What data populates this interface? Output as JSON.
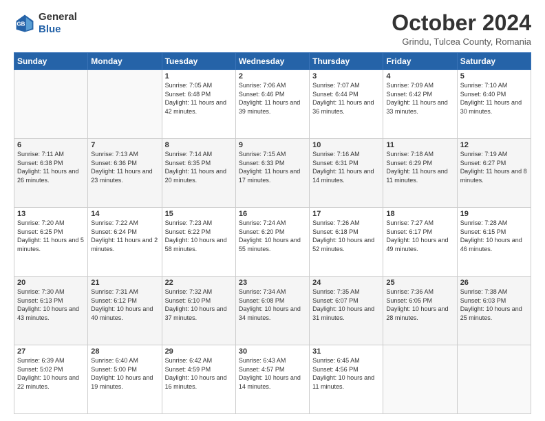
{
  "logo": {
    "line1": "General",
    "line2": "Blue"
  },
  "title": "October 2024",
  "subtitle": "Grindu, Tulcea County, Romania",
  "days_header": [
    "Sunday",
    "Monday",
    "Tuesday",
    "Wednesday",
    "Thursday",
    "Friday",
    "Saturday"
  ],
  "weeks": [
    [
      {
        "day": "",
        "info": ""
      },
      {
        "day": "",
        "info": ""
      },
      {
        "day": "1",
        "info": "Sunrise: 7:05 AM\nSunset: 6:48 PM\nDaylight: 11 hours and 42 minutes."
      },
      {
        "day": "2",
        "info": "Sunrise: 7:06 AM\nSunset: 6:46 PM\nDaylight: 11 hours and 39 minutes."
      },
      {
        "day": "3",
        "info": "Sunrise: 7:07 AM\nSunset: 6:44 PM\nDaylight: 11 hours and 36 minutes."
      },
      {
        "day": "4",
        "info": "Sunrise: 7:09 AM\nSunset: 6:42 PM\nDaylight: 11 hours and 33 minutes."
      },
      {
        "day": "5",
        "info": "Sunrise: 7:10 AM\nSunset: 6:40 PM\nDaylight: 11 hours and 30 minutes."
      }
    ],
    [
      {
        "day": "6",
        "info": "Sunrise: 7:11 AM\nSunset: 6:38 PM\nDaylight: 11 hours and 26 minutes."
      },
      {
        "day": "7",
        "info": "Sunrise: 7:13 AM\nSunset: 6:36 PM\nDaylight: 11 hours and 23 minutes."
      },
      {
        "day": "8",
        "info": "Sunrise: 7:14 AM\nSunset: 6:35 PM\nDaylight: 11 hours and 20 minutes."
      },
      {
        "day": "9",
        "info": "Sunrise: 7:15 AM\nSunset: 6:33 PM\nDaylight: 11 hours and 17 minutes."
      },
      {
        "day": "10",
        "info": "Sunrise: 7:16 AM\nSunset: 6:31 PM\nDaylight: 11 hours and 14 minutes."
      },
      {
        "day": "11",
        "info": "Sunrise: 7:18 AM\nSunset: 6:29 PM\nDaylight: 11 hours and 11 minutes."
      },
      {
        "day": "12",
        "info": "Sunrise: 7:19 AM\nSunset: 6:27 PM\nDaylight: 11 hours and 8 minutes."
      }
    ],
    [
      {
        "day": "13",
        "info": "Sunrise: 7:20 AM\nSunset: 6:25 PM\nDaylight: 11 hours and 5 minutes."
      },
      {
        "day": "14",
        "info": "Sunrise: 7:22 AM\nSunset: 6:24 PM\nDaylight: 11 hours and 2 minutes."
      },
      {
        "day": "15",
        "info": "Sunrise: 7:23 AM\nSunset: 6:22 PM\nDaylight: 10 hours and 58 minutes."
      },
      {
        "day": "16",
        "info": "Sunrise: 7:24 AM\nSunset: 6:20 PM\nDaylight: 10 hours and 55 minutes."
      },
      {
        "day": "17",
        "info": "Sunrise: 7:26 AM\nSunset: 6:18 PM\nDaylight: 10 hours and 52 minutes."
      },
      {
        "day": "18",
        "info": "Sunrise: 7:27 AM\nSunset: 6:17 PM\nDaylight: 10 hours and 49 minutes."
      },
      {
        "day": "19",
        "info": "Sunrise: 7:28 AM\nSunset: 6:15 PM\nDaylight: 10 hours and 46 minutes."
      }
    ],
    [
      {
        "day": "20",
        "info": "Sunrise: 7:30 AM\nSunset: 6:13 PM\nDaylight: 10 hours and 43 minutes."
      },
      {
        "day": "21",
        "info": "Sunrise: 7:31 AM\nSunset: 6:12 PM\nDaylight: 10 hours and 40 minutes."
      },
      {
        "day": "22",
        "info": "Sunrise: 7:32 AM\nSunset: 6:10 PM\nDaylight: 10 hours and 37 minutes."
      },
      {
        "day": "23",
        "info": "Sunrise: 7:34 AM\nSunset: 6:08 PM\nDaylight: 10 hours and 34 minutes."
      },
      {
        "day": "24",
        "info": "Sunrise: 7:35 AM\nSunset: 6:07 PM\nDaylight: 10 hours and 31 minutes."
      },
      {
        "day": "25",
        "info": "Sunrise: 7:36 AM\nSunset: 6:05 PM\nDaylight: 10 hours and 28 minutes."
      },
      {
        "day": "26",
        "info": "Sunrise: 7:38 AM\nSunset: 6:03 PM\nDaylight: 10 hours and 25 minutes."
      }
    ],
    [
      {
        "day": "27",
        "info": "Sunrise: 6:39 AM\nSunset: 5:02 PM\nDaylight: 10 hours and 22 minutes."
      },
      {
        "day": "28",
        "info": "Sunrise: 6:40 AM\nSunset: 5:00 PM\nDaylight: 10 hours and 19 minutes."
      },
      {
        "day": "29",
        "info": "Sunrise: 6:42 AM\nSunset: 4:59 PM\nDaylight: 10 hours and 16 minutes."
      },
      {
        "day": "30",
        "info": "Sunrise: 6:43 AM\nSunset: 4:57 PM\nDaylight: 10 hours and 14 minutes."
      },
      {
        "day": "31",
        "info": "Sunrise: 6:45 AM\nSunset: 4:56 PM\nDaylight: 10 hours and 11 minutes."
      },
      {
        "day": "",
        "info": ""
      },
      {
        "day": "",
        "info": ""
      }
    ]
  ]
}
